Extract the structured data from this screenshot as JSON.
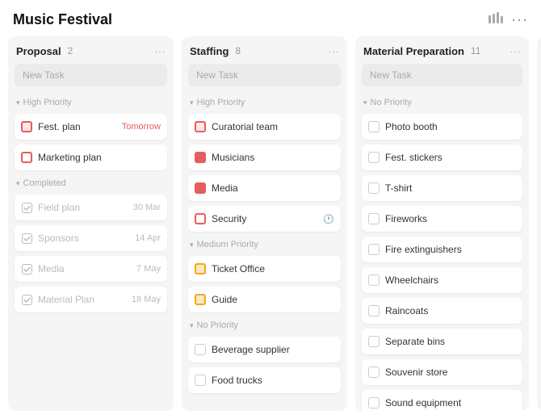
{
  "app": {
    "title": "Music Festival"
  },
  "header": {
    "chart_icon": "▐▐▐",
    "more_icon": "•••"
  },
  "columns": [
    {
      "id": "proposal",
      "title": "Proposal",
      "count": "2",
      "new_task_placeholder": "New Task",
      "sections": [
        {
          "label": "High Priority",
          "tasks": [
            {
              "id": "fest-plan",
              "name": "Fest. plan",
              "icon": "high",
              "date": "Tomorrow",
              "date_class": "tomorrow"
            },
            {
              "id": "marketing-plan",
              "name": "Marketing plan",
              "icon": "high-light",
              "date": "",
              "date_class": ""
            }
          ]
        },
        {
          "label": "Completed",
          "tasks": [
            {
              "id": "field-plan",
              "name": "Field plan",
              "icon": "completed",
              "date": "30 Mar",
              "date_class": ""
            },
            {
              "id": "sponsors",
              "name": "Sponsors",
              "icon": "completed",
              "date": "14 Apr",
              "date_class": ""
            },
            {
              "id": "media",
              "name": "Media",
              "icon": "completed",
              "date": "7 May",
              "date_class": ""
            },
            {
              "id": "material-plan",
              "name": "Material Plan",
              "icon": "completed",
              "date": "18 May",
              "date_class": ""
            }
          ]
        }
      ]
    },
    {
      "id": "staffing",
      "title": "Staffing",
      "count": "8",
      "new_task_placeholder": "New Task",
      "sections": [
        {
          "label": "High Priority",
          "tasks": [
            {
              "id": "curatorial-team",
              "name": "Curatorial team",
              "icon": "high",
              "date": "",
              "date_class": ""
            },
            {
              "id": "musicians",
              "name": "Musicians",
              "icon": "high-filled",
              "date": "",
              "date_class": ""
            },
            {
              "id": "media-staff",
              "name": "Media",
              "icon": "high-filled2",
              "date": "",
              "date_class": ""
            },
            {
              "id": "security",
              "name": "Security",
              "icon": "high-light",
              "date": "",
              "date_class": "",
              "has_clock": true
            }
          ]
        },
        {
          "label": "Medium Priority",
          "tasks": [
            {
              "id": "ticket-office",
              "name": "Ticket Office",
              "icon": "medium",
              "date": "",
              "date_class": ""
            },
            {
              "id": "guide",
              "name": "Guide",
              "icon": "medium",
              "date": "",
              "date_class": ""
            }
          ]
        },
        {
          "label": "No Priority",
          "tasks": [
            {
              "id": "beverage-supplier",
              "name": "Beverage supplier",
              "icon": "none",
              "date": "",
              "date_class": ""
            },
            {
              "id": "food-trucks",
              "name": "Food trucks",
              "icon": "none",
              "date": "",
              "date_class": ""
            }
          ]
        }
      ]
    },
    {
      "id": "material-preparation",
      "title": "Material Preparation",
      "count": "11",
      "new_task_placeholder": "New Task",
      "sections": [
        {
          "label": "No Priority",
          "tasks": [
            {
              "id": "photo-booth",
              "name": "Photo booth",
              "icon": "none",
              "date": "",
              "date_class": ""
            },
            {
              "id": "fest-stickers",
              "name": "Fest. stickers",
              "icon": "none",
              "date": "",
              "date_class": ""
            },
            {
              "id": "t-shirt",
              "name": "T-shirt",
              "icon": "none",
              "date": "",
              "date_class": ""
            },
            {
              "id": "fireworks",
              "name": "Fireworks",
              "icon": "none",
              "date": "",
              "date_class": ""
            },
            {
              "id": "fire-extinguishers",
              "name": "Fire extinguishers",
              "icon": "none",
              "date": "",
              "date_class": ""
            },
            {
              "id": "wheelchairs",
              "name": "Wheelchairs",
              "icon": "none",
              "date": "",
              "date_class": ""
            },
            {
              "id": "raincoats",
              "name": "Raincoats",
              "icon": "none",
              "date": "",
              "date_class": ""
            },
            {
              "id": "separate-bins",
              "name": "Separate bins",
              "icon": "none",
              "date": "",
              "date_class": ""
            },
            {
              "id": "souvenir-store",
              "name": "Souvenir store",
              "icon": "none",
              "date": "",
              "date_class": ""
            },
            {
              "id": "sound-equipment",
              "name": "Sound equipment",
              "icon": "none",
              "date": "",
              "date_class": ""
            }
          ]
        }
      ]
    }
  ]
}
